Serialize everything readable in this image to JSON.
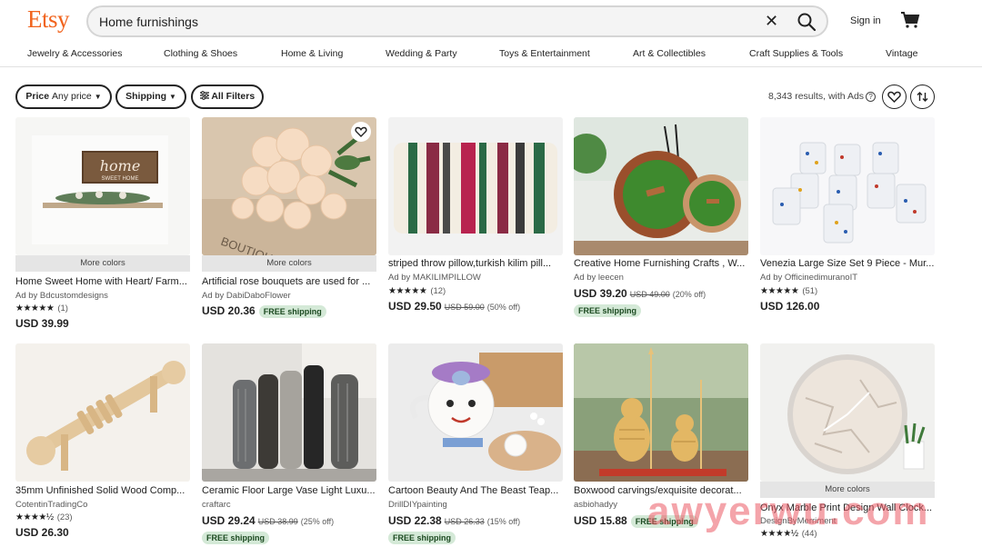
{
  "header": {
    "logo": "Etsy",
    "search_value": "Home furnishings",
    "signin_label": "Sign in"
  },
  "categories": [
    "Jewelry & Accessories",
    "Clothing & Shoes",
    "Home & Living",
    "Wedding & Party",
    "Toys & Entertainment",
    "Art & Collectibles",
    "Craft Supplies & Tools",
    "Vintage"
  ],
  "filters": {
    "price_label": "Price",
    "price_value": "Any price",
    "shipping_label": "Shipping",
    "all_filters_label": "All Filters",
    "results_text": "8,343 results, with Ads"
  },
  "badges": {
    "more_colors": "More colors",
    "free_shipping": "FREE shipping"
  },
  "listings": [
    {
      "title": "Home Sweet Home with Heart/ Farm...",
      "seller": "Ad by Bdcustomdesigns",
      "stars": "★★★★★",
      "reviews": "(1)",
      "price": "USD 39.99",
      "orig": "",
      "pct": "",
      "more_colors": true,
      "free_shipping": false
    },
    {
      "title": "Artificial rose bouquets are used for ...",
      "seller": "Ad by DabiDaboFlower",
      "stars": "",
      "reviews": "",
      "price": "USD 20.36",
      "orig": "",
      "pct": "",
      "more_colors": true,
      "free_shipping": true
    },
    {
      "title": "striped throw pillow,turkish kilim pill...",
      "seller": "Ad by MAKILIMPILLOW",
      "stars": "★★★★★",
      "reviews": "(12)",
      "price": "USD 29.50",
      "orig": "USD 59.00",
      "pct": "(50% off)",
      "more_colors": false,
      "free_shipping": false
    },
    {
      "title": "Creative Home Furnishing Crafts , W...",
      "seller": "Ad by leecen",
      "stars": "",
      "reviews": "",
      "price": "USD 39.20",
      "orig": "USD 49.00",
      "pct": "(20% off)",
      "more_colors": false,
      "free_shipping": true
    },
    {
      "title": "Venezia Large Size Set 9 Piece - Mur...",
      "seller": "Ad by OfficinedimuranoIT",
      "stars": "★★★★★",
      "reviews": "(51)",
      "price": "USD 126.00",
      "orig": "",
      "pct": "",
      "more_colors": false,
      "free_shipping": false
    },
    {
      "title": "35mm Unfinished Solid Wood Comp...",
      "seller": "CotentinTradingCo",
      "stars": "★★★★½",
      "reviews": "(23)",
      "price": "USD 26.30",
      "orig": "",
      "pct": "",
      "more_colors": false,
      "free_shipping": false
    },
    {
      "title": "Ceramic Floor Large Vase Light Luxu...",
      "seller": "craftarc",
      "stars": "",
      "reviews": "",
      "price": "USD 29.24",
      "orig": "USD 38.99",
      "pct": "(25% off)",
      "more_colors": false,
      "free_shipping": true
    },
    {
      "title": "Cartoon Beauty And The Beast Teap...",
      "seller": "DrillDIYpainting",
      "stars": "",
      "reviews": "",
      "price": "USD 22.38",
      "orig": "USD 26.33",
      "pct": "(15% off)",
      "more_colors": false,
      "free_shipping": true
    },
    {
      "title": "Boxwood carvings/exquisite decorat...",
      "seller": "asbiohadyy",
      "stars": "",
      "reviews": "",
      "price": "USD 15.88",
      "orig": "",
      "pct": "",
      "more_colors": false,
      "free_shipping": true
    },
    {
      "title": "Onyx Marble Print Design Wall Clock...",
      "seller": "DesignByMerriment",
      "stars": "★★★★½",
      "reviews": "(44)",
      "price": "",
      "orig": "",
      "pct": "",
      "more_colors": true,
      "free_shipping": false
    }
  ],
  "watermark": "awyerwu.com",
  "colors": {
    "brand": "#f1641e",
    "free_shipping_bg": "#d4e9d7"
  }
}
